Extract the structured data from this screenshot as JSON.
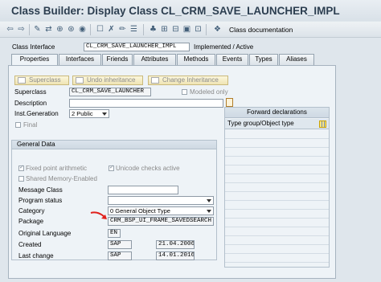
{
  "window": {
    "title": "Class Builder: Display Class CL_CRM_SAVE_LAUNCHER_IMPL"
  },
  "toolbar": {
    "icons": [
      "back-icon",
      "forward-icon",
      "other-object-icon",
      "display-change-icon",
      "where-used-icon",
      "activate-icon",
      "test-icon",
      "check-icon",
      "delete-icon",
      "edit-icon",
      "object-list-icon",
      "navigation-icon",
      "hierarchy-icon",
      "compare-icon",
      "info-icon",
      "local-types-icon",
      "help-icon"
    ],
    "class_doc_label": "Class documentation"
  },
  "header": {
    "class_interface_label": "Class Interface",
    "class_interface_value": "CL_CRM_SAVE_LAUNCHER_IMPL",
    "status": "Implemented / Active"
  },
  "tabs": [
    "Properties",
    "Interfaces",
    "Friends",
    "Attributes",
    "Methods",
    "Events",
    "Types",
    "Aliases"
  ],
  "active_tab": "Properties",
  "buttons": {
    "superclass": "Superclass",
    "undo_inheritance": "Undo inheritance",
    "change_inheritance": "Change Inheritance"
  },
  "form": {
    "superclass_label": "Superclass",
    "superclass_value": "CL_CRM_SAVE_LAUNCHER",
    "modeled_only_label": "Modeled only",
    "description_label": "Description",
    "description_value": "",
    "inst_generation_label": "Inst.Generation",
    "inst_generation_value": "2 Public",
    "final_label": "Final"
  },
  "general_data": {
    "title": "General Data",
    "fixed_point_label": "Fixed point arithmetic",
    "unicode_label": "Unicode checks active",
    "shared_memory_label": "Shared Memory-Enabled",
    "message_class_label": "Message Class",
    "message_class_value": "",
    "program_status_label": "Program status",
    "program_status_value": "",
    "category_label": "Category",
    "category_value": "0 General Object Type",
    "package_label": "Package",
    "package_value": "CRM_BSP_UI_FRAME_SAVEDSEARCH",
    "orig_lang_label": "Original Language",
    "orig_lang_value": "EN",
    "created_label": "Created",
    "created_by": "SAP",
    "created_date": "21.04.2006",
    "last_change_label": "Last change",
    "changed_by": "SAP",
    "changed_date": "14.01.2016"
  },
  "forward_declarations": {
    "title": "Forward declarations",
    "column": "Type group/Object type"
  },
  "colors": {
    "annotation_arrow": "#e0201c",
    "button_bg": "#f3ebc6"
  }
}
